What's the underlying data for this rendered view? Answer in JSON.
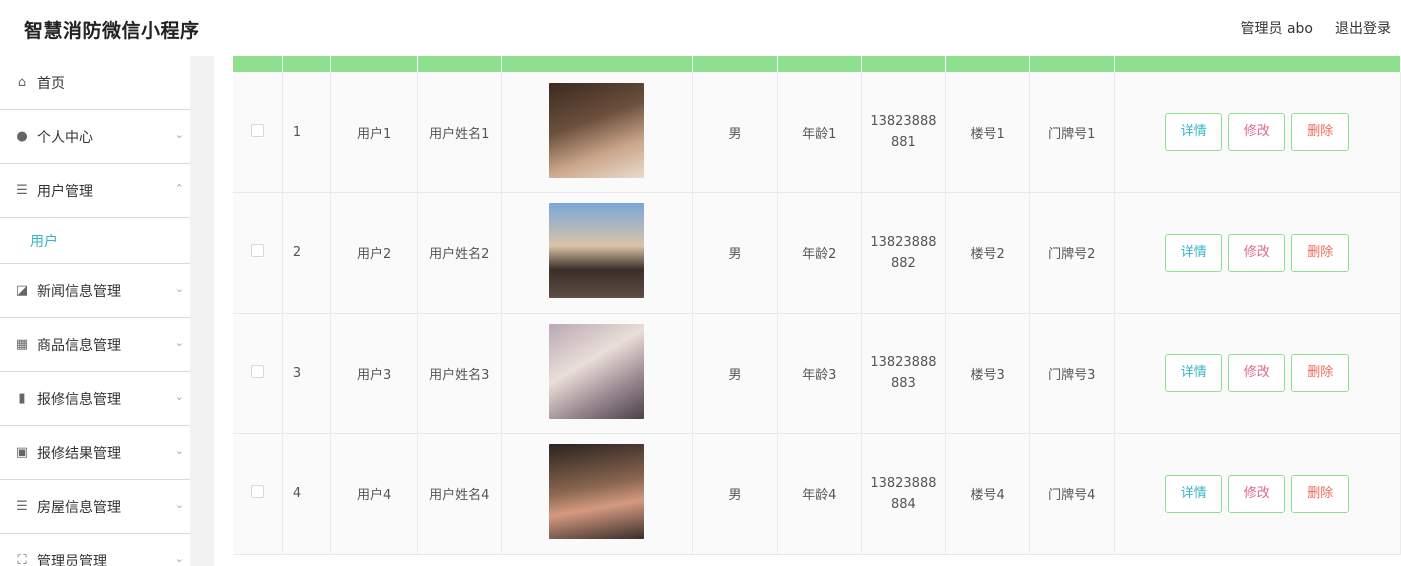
{
  "app": {
    "title": "智慧消防微信小程序"
  },
  "header": {
    "user": "管理员 abo",
    "logout": "退出登录"
  },
  "sidebar": {
    "items": [
      {
        "label": "首页",
        "icon": "home-icon",
        "glyph": "⌂",
        "chevron": ""
      },
      {
        "label": "个人中心",
        "icon": "user-icon",
        "glyph": "●",
        "chevron": "⌄"
      },
      {
        "label": "用户管理",
        "icon": "list-icon",
        "glyph": "☰",
        "chevron": "⌃"
      },
      {
        "label": "新闻信息管理",
        "icon": "chart-area-icon",
        "glyph": "◪",
        "chevron": "⌄"
      },
      {
        "label": "商品信息管理",
        "icon": "grid-icon",
        "glyph": "▦",
        "chevron": "⌄"
      },
      {
        "label": "报修信息管理",
        "icon": "bar-chart-icon",
        "glyph": "▮",
        "chevron": "⌄"
      },
      {
        "label": "报修结果管理",
        "icon": "clipboard-icon",
        "glyph": "▣",
        "chevron": "⌄"
      },
      {
        "label": "房屋信息管理",
        "icon": "list-icon",
        "glyph": "☰",
        "chevron": "⌄"
      },
      {
        "label": "管理员管理",
        "icon": "frame-icon",
        "glyph": "⛶",
        "chevron": "⌄"
      }
    ],
    "sub_item": "用户"
  },
  "table": {
    "buttons": {
      "detail": "详情",
      "edit": "修改",
      "delete": "删除"
    },
    "rows": [
      {
        "index": "1",
        "account": "用户1",
        "name": "用户姓名1",
        "gender": "男",
        "age": "年龄1",
        "phone_a": "13823888",
        "phone_b": "881",
        "building": "楼号1",
        "door": "门牌号1"
      },
      {
        "index": "2",
        "account": "用户2",
        "name": "用户姓名2",
        "gender": "男",
        "age": "年龄2",
        "phone_a": "13823888",
        "phone_b": "882",
        "building": "楼号2",
        "door": "门牌号2"
      },
      {
        "index": "3",
        "account": "用户3",
        "name": "用户姓名3",
        "gender": "男",
        "age": "年龄3",
        "phone_a": "13823888",
        "phone_b": "883",
        "building": "楼号3",
        "door": "门牌号3"
      },
      {
        "index": "4",
        "account": "用户4",
        "name": "用户姓名4",
        "gender": "男",
        "age": "年龄4",
        "phone_a": "13823888",
        "phone_b": "884",
        "building": "楼号4",
        "door": "门牌号4"
      }
    ]
  },
  "colors": {
    "header_green": "#8ee08e",
    "accent_teal": "#35b5c5",
    "edit_pink": "#e0698a",
    "delete_red": "#f06a5a"
  }
}
